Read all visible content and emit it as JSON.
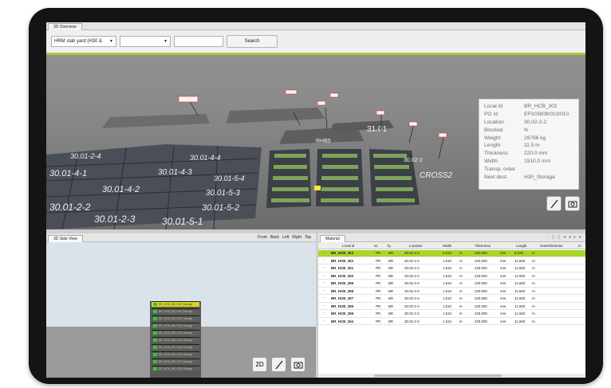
{
  "overview": {
    "tab_label": "3D Overview",
    "yard_select": "HRM slab yard (H30 & ",
    "second_select": "",
    "search_value": "",
    "search_label": "Search"
  },
  "scene": {
    "grid_labels_left": [
      "30.01-4-1",
      "30.01-4-2",
      "30.01-4-3",
      "30.01-4-4",
      "30.01-5-1",
      "30.01-5-2",
      "30.01-5-3",
      "30.01-5-4",
      "30.01-2-2",
      "30.01-2-3",
      "30.01-2-4"
    ],
    "tag_labels": [
      "31.01",
      "CROSS2",
      "RHB5",
      "30.02-2"
    ]
  },
  "info": {
    "rows": [
      {
        "k": "Local Id",
        "v": "BR_HCB_302"
      },
      {
        "k": "PO Id",
        "v": "EF003809/010/010"
      },
      {
        "k": "Location",
        "v": "30.02-2-2"
      },
      {
        "k": "Blocked",
        "v": "N"
      },
      {
        "k": "Weight",
        "v": "29796 kg"
      },
      {
        "k": "Length",
        "v": "11.5 m"
      },
      {
        "k": "Thickness",
        "v": "220.0 mm"
      },
      {
        "k": "Width",
        "v": "1510.0 mm"
      },
      {
        "k": "Transp. order",
        "v": ""
      },
      {
        "k": "Next dest.",
        "v": "H30_Storage"
      }
    ]
  },
  "sideview": {
    "tab_label": "3D Side View",
    "views": [
      "Front",
      "Back",
      "Left",
      "Right",
      "Top"
    ],
    "btn_2d": "2D",
    "slabs": [
      "BR_HCB_303 H30_Storage",
      "BR_HCB_302 H30_Storage",
      "BR_HCB_301 H30_Storage",
      "BR_HCB_300 H30_Storage",
      "BR_HCB_299 H30_Storage",
      "BR_HCB_298 H30_Storage",
      "BR_HCB_297 H30_Storage",
      "BR_HCB_296 H30_Storage",
      "BR_HCB_295 H30_Storage",
      "BR_HCB_294 H30_Storage"
    ]
  },
  "material": {
    "tab_label": "Material",
    "columns": [
      "Local Id",
      "M..",
      "Ty..",
      "Location",
      "Width",
      "Thickness",
      "Length",
      "OuterDiameter",
      "In"
    ],
    "rows": [
      [
        "BR_HCB_303",
        "PR",
        "BR",
        "30.02-2-2",
        "2.010",
        "m",
        "220.000",
        "mm",
        "8.100",
        "m"
      ],
      [
        "BR_HCB_302",
        "PR",
        "BR",
        "30.02-2-2",
        "1.510",
        "m",
        "220.000",
        "mm",
        "11.500",
        "m"
      ],
      [
        "BR_HCB_301",
        "PR",
        "BR",
        "30.02-2-2",
        "1.510",
        "m",
        "220.000",
        "mm",
        "11.500",
        "m"
      ],
      [
        "BR_HCB_300",
        "PR",
        "BR",
        "30.02-2-2",
        "1.510",
        "m",
        "220.000",
        "mm",
        "11.500",
        "m"
      ],
      [
        "BR_HCB_299",
        "PR",
        "BR",
        "30.02-2-2",
        "1.510",
        "m",
        "220.000",
        "mm",
        "11.500",
        "m"
      ],
      [
        "BR_HCB_298",
        "PR",
        "BR",
        "30.02-2-2",
        "1.510",
        "m",
        "220.000",
        "mm",
        "11.500",
        "m"
      ],
      [
        "BR_HCB_297",
        "PR",
        "BR",
        "30.02-2-2",
        "1.510",
        "m",
        "220.000",
        "mm",
        "11.500",
        "m"
      ],
      [
        "BR_HCB_296",
        "PR",
        "BR",
        "30.02-2-2",
        "1.510",
        "m",
        "220.000",
        "mm",
        "11.500",
        "m"
      ],
      [
        "BR_HCB_295",
        "PR",
        "BR",
        "30.02-2-2",
        "1.510",
        "m",
        "220.000",
        "mm",
        "11.500",
        "m"
      ],
      [
        "BR_HCB_294",
        "PR",
        "BR",
        "30.02-2-2",
        "1.510",
        "m",
        "220.000",
        "mm",
        "11.500",
        "m"
      ]
    ]
  },
  "colors": {
    "selection": "#a9d62b",
    "accent_line": "#a9cc3a",
    "slab_green": "#38c238",
    "slab_highlight": "#d9d91e"
  }
}
